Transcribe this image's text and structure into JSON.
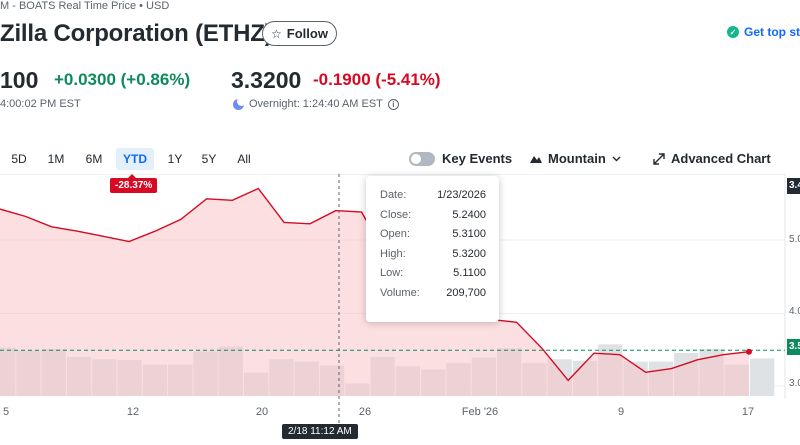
{
  "header": {
    "source": "M - BOATS Real Time Price • USD",
    "company_name": "Zilla Corporation (ETHZ)",
    "follow_label": "Follow",
    "top_stories_label": "Get top sto"
  },
  "quote": {
    "close_price": "100",
    "close_change": "+0.0300 (+0.86%)",
    "close_time": "4:00:02 PM EST",
    "overnight_price": "3.3200",
    "overnight_change": "-0.1900 (-5.41%)",
    "overnight_time": "Overnight: 1:24:40 AM EST"
  },
  "range_tabs": [
    "5D",
    "1M",
    "6M",
    "YTD",
    "1Y",
    "5Y",
    "All"
  ],
  "active_range": "YTD",
  "controls": {
    "key_events_label": "Key Events",
    "chart_type_label": "Mountain",
    "advanced_label": "Advanced Chart"
  },
  "colors": {
    "line": "#d60a22",
    "area": "#f7c4c8",
    "positive": "#0f8a5c",
    "negative": "#d60a22",
    "accent": "#0f69ff",
    "volume": "#dfe2e5"
  },
  "chart": {
    "ytd_change": "-28.37%",
    "hover_date_label": "2/18 11:12 AM",
    "x_labels": [
      "5",
      "12",
      "20",
      "26",
      "Feb '26",
      "9",
      "17"
    ],
    "y_labels": [
      "5.0",
      "4.0",
      "3.0"
    ],
    "y_badge_top": "3.4",
    "y_badge_current": "3.5",
    "tooltip": {
      "date_label": "Date:",
      "date": "1/23/2026",
      "close_label": "Close:",
      "close": "5.2400",
      "open_label": "Open:",
      "open": "5.3100",
      "high_label": "High:",
      "high": "5.3200",
      "low_label": "Low:",
      "low": "5.1100",
      "volume_label": "Volume:",
      "volume": "209,700"
    }
  },
  "chart_data": {
    "type": "area",
    "prices": [
      5.42,
      5.32,
      5.18,
      5.12,
      5.05,
      4.98,
      5.12,
      5.28,
      5.56,
      5.54,
      5.7,
      5.24,
      5.22,
      5.4,
      5.38,
      4.76,
      4.98,
      4.78,
      4.26,
      3.92,
      3.88,
      3.52,
      3.09,
      3.46,
      3.44,
      3.2,
      3.25,
      3.37,
      3.44,
      3.48
    ],
    "volumes": [
      0.62,
      0.58,
      0.6,
      0.5,
      0.47,
      0.46,
      0.4,
      0.4,
      0.57,
      0.63,
      0.3,
      0.47,
      0.44,
      0.39,
      0.16,
      0.5,
      0.38,
      0.34,
      0.42,
      0.49,
      0.61,
      0.42,
      0.47,
      0.45,
      0.66,
      0.44,
      0.44,
      0.55,
      0.6,
      0.4,
      0.48
    ],
    "reference": 3.5
  }
}
